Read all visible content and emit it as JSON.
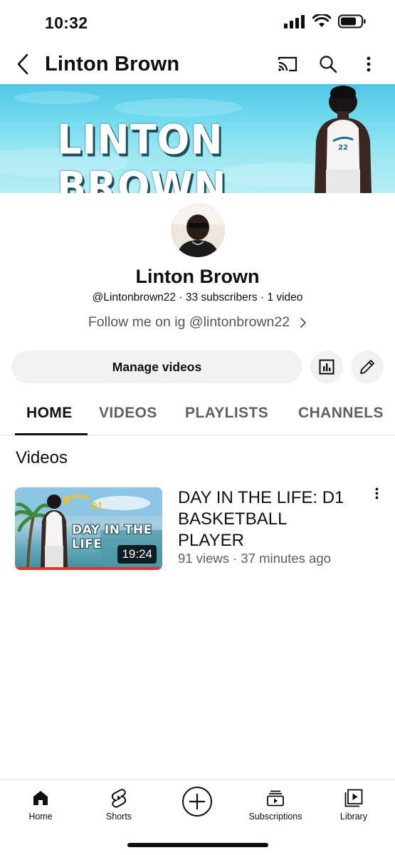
{
  "status_bar": {
    "time": "10:32"
  },
  "app_bar": {
    "title": "Linton Brown"
  },
  "banner": {
    "text": "LINTON BROWN"
  },
  "channel": {
    "name": "Linton Brown",
    "meta": "@Lintonbrown22 · 33 subscribers · 1 video",
    "description": "Follow me on ig @lintonbrown22"
  },
  "actions": {
    "manage_label": "Manage videos"
  },
  "tabs": [
    {
      "label": "HOME",
      "active": true
    },
    {
      "label": "VIDEOS",
      "active": false
    },
    {
      "label": "PLAYLISTS",
      "active": false
    },
    {
      "label": "CHANNELS",
      "active": false
    }
  ],
  "section": {
    "title": "Videos"
  },
  "video": {
    "title": "DAY IN THE LIFE: D1 BASKETBALL PLAYER",
    "meta": "91 views · 37 minutes ago",
    "duration": "19:24",
    "thumb_text": "DAY IN THE LIFE",
    "thumb_badge": "D1",
    "progress_fraction": 1.0
  },
  "bottom_nav": [
    {
      "label": "Home",
      "icon": "home-icon"
    },
    {
      "label": "Shorts",
      "icon": "shorts-icon"
    },
    {
      "label": "",
      "icon": "create-icon"
    },
    {
      "label": "Subscriptions",
      "icon": "subscriptions-icon"
    },
    {
      "label": "Library",
      "icon": "library-icon"
    }
  ],
  "colors": {
    "accent_red": "#e5332a",
    "text": "#0f0f0f",
    "secondary": "#606060",
    "chip": "#f2f2f2"
  }
}
